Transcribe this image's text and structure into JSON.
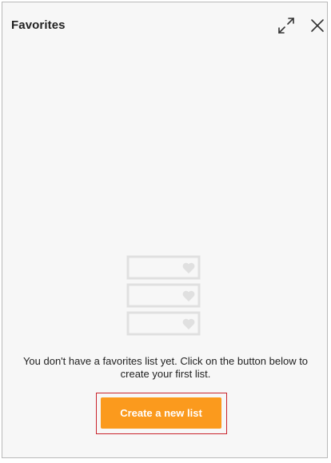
{
  "panel": {
    "title": "Favorites"
  },
  "header_icons": {
    "expand": "expand-icon",
    "close": "close-icon"
  },
  "empty_state": {
    "illustration": "favorites-list-illustration",
    "message_line1": "You don't have a favorites list yet. Click on the button below to",
    "message_line2": "create your first list.",
    "button_label": "Create a new list"
  },
  "colors": {
    "accent": "#fb9a1d",
    "highlight_border": "#c9242c",
    "panel_background": "#f7f7f7",
    "illustration": "#e0e0e0"
  }
}
